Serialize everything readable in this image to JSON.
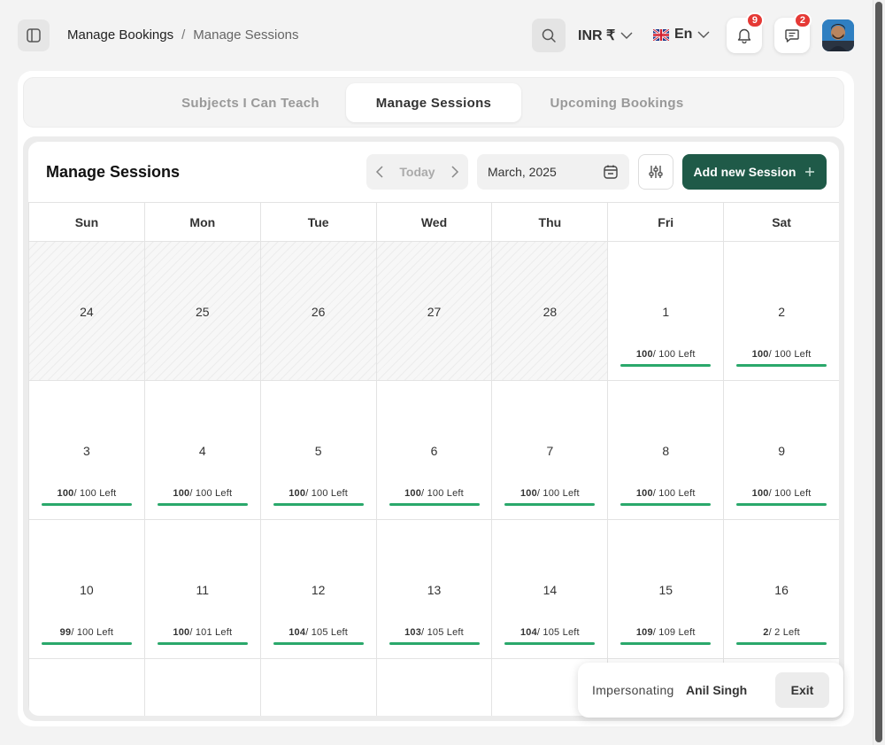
{
  "header": {
    "breadcrumb": [
      "Manage Bookings",
      "/",
      "Manage Sessions"
    ],
    "currency": "INR ₹",
    "language": "En",
    "notifications_count": "9",
    "messages_count": "2"
  },
  "tabs": [
    {
      "label": "Subjects I Can Teach",
      "active": false
    },
    {
      "label": "Manage Sessions",
      "active": true
    },
    {
      "label": "Upcoming Bookings",
      "active": false
    }
  ],
  "calendar": {
    "title": "Manage Sessions",
    "today_label": "Today",
    "month_value": "March, 2025",
    "add_button_label": "Add new Session",
    "weekdays": [
      "Sun",
      "Mon",
      "Tue",
      "Wed",
      "Thu",
      "Fri",
      "Sat"
    ],
    "weeks": [
      [
        {
          "day": "24",
          "past": true
        },
        {
          "day": "25",
          "past": true
        },
        {
          "day": "26",
          "past": true
        },
        {
          "day": "27",
          "past": true
        },
        {
          "day": "28",
          "past": true
        },
        {
          "day": "1",
          "left": "100",
          "total": "100"
        },
        {
          "day": "2",
          "left": "100",
          "total": "100"
        }
      ],
      [
        {
          "day": "3",
          "left": "100",
          "total": "100"
        },
        {
          "day": "4",
          "left": "100",
          "total": "100"
        },
        {
          "day": "5",
          "left": "100",
          "total": "100"
        },
        {
          "day": "6",
          "left": "100",
          "total": "100"
        },
        {
          "day": "7",
          "left": "100",
          "total": "100"
        },
        {
          "day": "8",
          "left": "100",
          "total": "100"
        },
        {
          "day": "9",
          "left": "100",
          "total": "100"
        }
      ],
      [
        {
          "day": "10",
          "left": "99",
          "total": "100"
        },
        {
          "day": "11",
          "left": "100",
          "total": "101"
        },
        {
          "day": "12",
          "left": "104",
          "total": "105"
        },
        {
          "day": "13",
          "left": "103",
          "total": "105"
        },
        {
          "day": "14",
          "left": "104",
          "total": "105"
        },
        {
          "day": "15",
          "left": "109",
          "total": "109"
        },
        {
          "day": "16",
          "left": "2",
          "total": "2"
        }
      ]
    ],
    "left_suffix": " Left",
    "accent_color": "#2aa86b",
    "primary_color": "#1f5a48"
  },
  "impersonation": {
    "label": "Impersonating",
    "name": "Anil Singh",
    "exit_label": "Exit"
  }
}
